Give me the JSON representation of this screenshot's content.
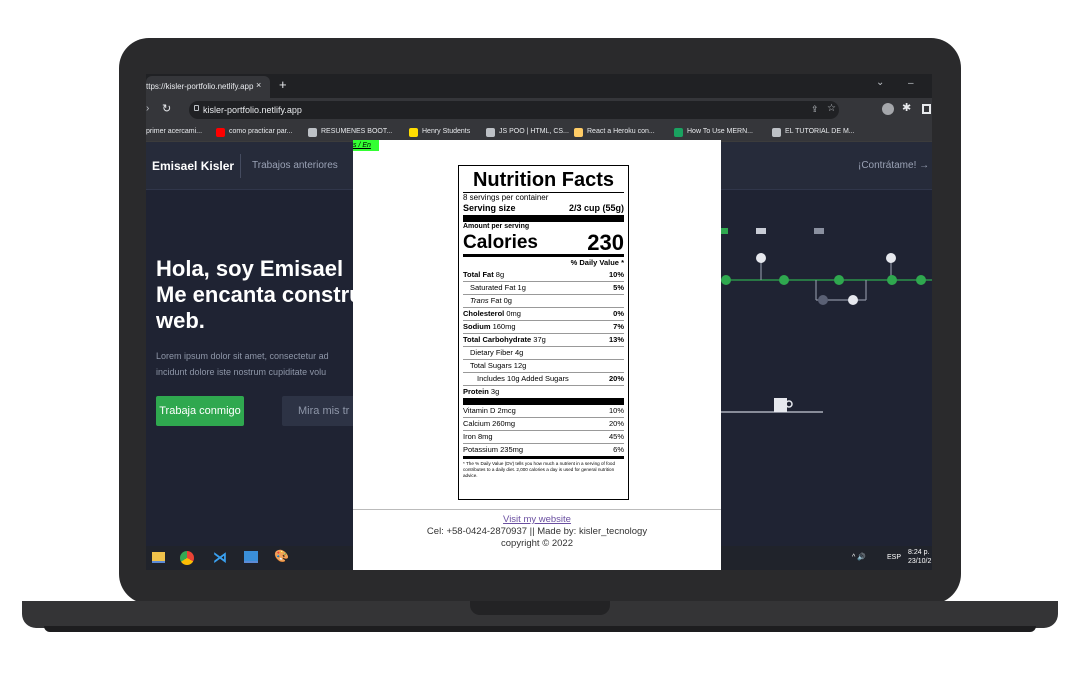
{
  "browser": {
    "tab_title": "ttps://kisler-portfolio.netlify.app",
    "tab_close": "×",
    "new_tab": "+",
    "url": "kisler-portfolio.netlify.app",
    "bookmarks": [
      {
        "label": "primer acercami...",
        "icon_color": "#35363a"
      },
      {
        "label": "como practicar par...",
        "icon_color": "#ff0000"
      },
      {
        "label": "RESUMENES BOOT...",
        "icon_color": "#bdc1c6"
      },
      {
        "label": "Henry Students",
        "icon_color": "#ffdd00"
      },
      {
        "label": "JS POO | HTML, CS...",
        "icon_color": "#bdc1c6"
      },
      {
        "label": "React a Heroku con...",
        "icon_color": "#ffcc66"
      },
      {
        "label": "How To Use MERN...",
        "icon_color": "#1aa260"
      },
      {
        "label": "EL TUTORIAL DE M...",
        "icon_color": "#bdc1c6"
      }
    ]
  },
  "site": {
    "brand": "Emisael Kisler",
    "nav_link": "Trabajos anteriores",
    "nav_cta": "¡Contrátame! →",
    "hero_line1": "Hola, soy Emisael",
    "hero_line2": "Me encanta constru",
    "hero_line3": "web.",
    "lorem1": "Lorem ipsum dolor sit amet, consectetur ad",
    "lorem2": "incidunt dolore iste nostrum cupiditate volu",
    "btn_primary": "Trabaja conmigo",
    "btn_secondary": "Mira mis tr"
  },
  "overlay": {
    "lang_toggle": "s / En",
    "footer_link": "Visit my website",
    "footer_contact": "Cel: +58-0424-2870937 || Made by: kisler_tecnology",
    "footer_copy": "copyright © 2022"
  },
  "nutrition": {
    "title": "Nutrition Facts",
    "servings": "8 servings per container",
    "serving_size_label": "Serving size",
    "serving_size_value": "2/3 cup (55g)",
    "amount_per_serving": "Amount per serving",
    "calories_label": "Calories",
    "calories_value": "230",
    "dv_header": "% Daily Value *",
    "rows": [
      {
        "bold": "Total Fat",
        "rest": " 8g",
        "pct": "10%",
        "indent": 0
      },
      {
        "bold": "",
        "rest": "Saturated Fat 1g",
        "pct": "5%",
        "indent": 1
      },
      {
        "bold": "",
        "rest": "Trans Fat 0g",
        "pct": "",
        "indent": 1
      },
      {
        "bold": "Cholesterol",
        "rest": " 0mg",
        "pct": "0%",
        "indent": 0
      },
      {
        "bold": "Sodium",
        "rest": " 160mg",
        "pct": "7%",
        "indent": 0
      },
      {
        "bold": "Total Carbohydrate",
        "rest": " 37g",
        "pct": "13%",
        "indent": 0
      },
      {
        "bold": "",
        "rest": "Dietary Fiber 4g",
        "pct": "",
        "indent": 1
      },
      {
        "bold": "",
        "rest": "Total Sugars 12g",
        "pct": "",
        "indent": 1
      },
      {
        "bold": "",
        "rest": "Includes 10g Added Sugars",
        "pct": "20%",
        "indent": 2
      },
      {
        "bold": "Protein",
        "rest": " 3g",
        "pct": "",
        "indent": 0
      }
    ],
    "vitamins": [
      {
        "label": "Vitamin D 2mcg",
        "pct": "10%"
      },
      {
        "label": "Calcium 260mg",
        "pct": "20%"
      },
      {
        "label": "Iron 8mg",
        "pct": "45%"
      },
      {
        "label": "Potassium 235mg",
        "pct": "6%"
      }
    ],
    "footnote": "* The % Daily Value (DV) tells you how much a nutrient in a serving of food contributes to a daily diet. 2,000 calories a day is used for general nutrition advice."
  },
  "taskbar": {
    "lang": "ESP",
    "time": "8:24 p.",
    "date": "23/10/2"
  }
}
